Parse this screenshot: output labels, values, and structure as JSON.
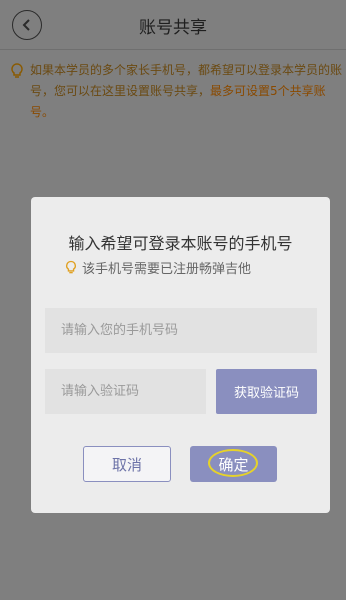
{
  "header": {
    "title": "账号共享",
    "back_icon": "chevron-left-icon"
  },
  "notice": {
    "icon": "lightbulb-icon",
    "text": "如果本学员的多个家长手机号，都希望可以登录本学员的账号，您可以在这里设置账号共享，",
    "highlight": "最多可设置5个共享账号。",
    "highlight_color": "#e08a1a"
  },
  "dialog": {
    "title": "输入希望可登录本账号的手机号",
    "hint": "该手机号需要已注册畅弹吉他",
    "hint_icon": "lightbulb-icon",
    "phone_input": {
      "value": "",
      "placeholder": "请输入您的手机号码"
    },
    "code_input": {
      "value": "",
      "placeholder": "请输入验证码"
    },
    "get_code_label": "获取验证码",
    "cancel_label": "取消",
    "confirm_label": "确定",
    "accent_color": "#8a8fbf",
    "annotation_color": "#e6d22a"
  }
}
